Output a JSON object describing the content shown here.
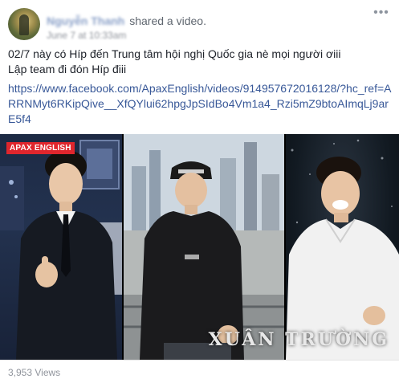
{
  "post": {
    "author_name": "Nguyễn Thanh",
    "action_text": "shared a video.",
    "timestamp": "June 7 at 10:33am",
    "options_icon": "ellipsis-icon",
    "body_lines": [
      "02/7 này có Híp đến Trung tâm hội nghị Quốc gia nè mọi người ơiii",
      "Lập team đi đón Híp điii"
    ],
    "link": "https://www.facebook.com/ApaxEnglish/videos/914957672016128/?hc_ref=ARRNMyt6RKipQive__XfQYlui62hpgJpSIdBo4Vm1a4_Rzi5mZ9btoAImqLj9arE5f4"
  },
  "media": {
    "badge": "APAX ENGLISH",
    "overlay_title": "XUÂN TRƯỜNG"
  },
  "footer": {
    "views": "3,953 Views"
  }
}
